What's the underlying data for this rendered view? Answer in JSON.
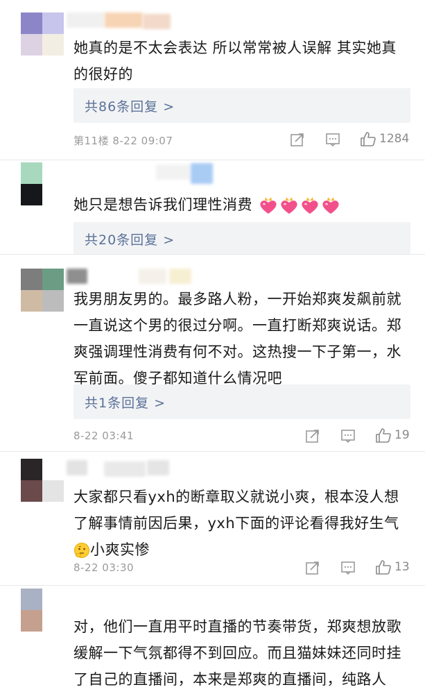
{
  "comments": [
    {
      "text": "她真的是不太会表达 所以常常被人误解   其实她真的很好的",
      "reply_label": "共86条回复 >",
      "meta": "第11楼  8-22 09:07",
      "likes": "1284"
    },
    {
      "text": "她只是想告诉我们理性消费",
      "reply_label": "共20条回复 >",
      "emoji_icons": [
        "heart-gift-icon",
        "heart-gift-icon",
        "heart-gift-icon",
        "heart-gift-icon"
      ]
    },
    {
      "text": "我男朋友男的。最多路人粉，一开始郑爽发飙前就一直说这个男的很过分啊。一直打断郑爽说话。郑爽强调理性消费有何不对。这热搜一下子第一，水军前面。傻子都知道什么情况吧",
      "reply_label": "共1条回复 >",
      "meta": "8-22 03:41",
      "likes": "19"
    },
    {
      "text_line1": "大家都只看yxh的断章取义就说小爽，根本没人想",
      "text_line2": "了解事情前因后果，yxh下面的评论看得我好生气",
      "text_line3": "小爽实惨",
      "emoji_icon": "thinking-face-icon",
      "meta": "8-22 03:30",
      "likes": "13"
    },
    {
      "text": "对，他们一直用平时直播的节奏带货，郑爽想放歌缓解一下气氛都得不到回应。而且猫妹妹还同时挂了自己的直播间，本来是郑爽的直播间，纯路人"
    }
  ],
  "colors": {
    "reply_link": "#5a7198",
    "meta_text": "#9a9a9a",
    "reply_bg": "#f2f3f5",
    "heart": "#f2508a"
  }
}
